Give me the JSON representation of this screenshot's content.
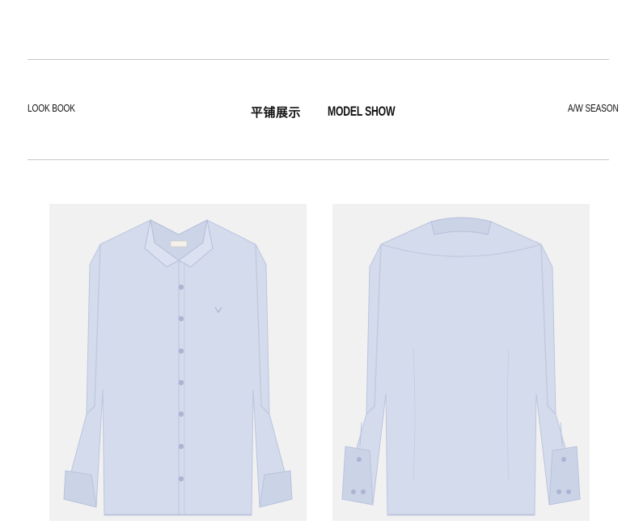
{
  "header": {
    "left_label": "LOOK BOOK",
    "center_cn": "平铺展示",
    "center_en": "MODEL SHOW",
    "right_label": "A/W SEASON"
  },
  "images": [
    {
      "name": "shirt-front-image",
      "icon": "shirt-front-icon"
    },
    {
      "name": "shirt-back-image",
      "icon": "shirt-back-icon"
    }
  ],
  "colors": {
    "shirt": "#d4dbec",
    "shirt_shadow": "#b9c3dc",
    "photo_bg": "#f1f1f2",
    "rule": "#c8c8c8"
  }
}
